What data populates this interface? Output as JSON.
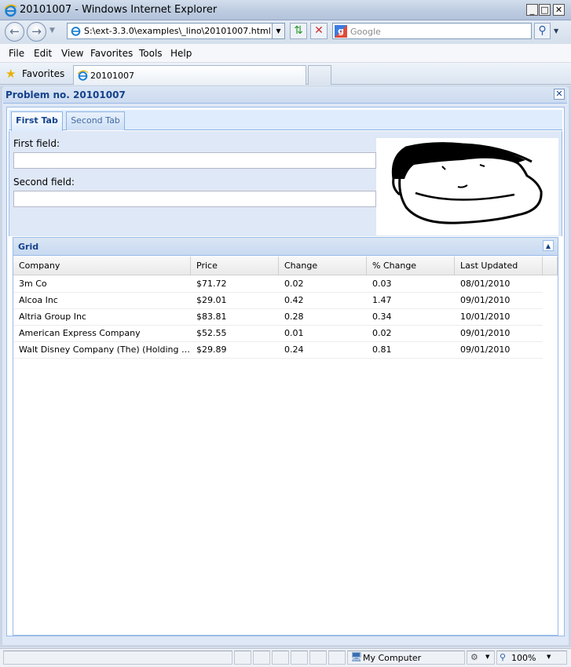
{
  "window": {
    "title": "20101007 - Windows Internet Explorer",
    "minimize": "_",
    "maximize": "□",
    "close": "✕"
  },
  "address_bar": {
    "url": "S:\\ext-3.3.0\\examples\\_lino\\20101007.html",
    "search_placeholder": "Google"
  },
  "menu": [
    "File",
    "Edit",
    "View",
    "Favorites",
    "Tools",
    "Help"
  ],
  "favorites": {
    "label": "Favorites",
    "tab_label": "20101007"
  },
  "panel": {
    "title": "Problem no. 20101007"
  },
  "tabs": [
    {
      "label": "First Tab",
      "active": true
    },
    {
      "label": "Second Tab",
      "active": false
    }
  ],
  "form": {
    "first_label": "First field:",
    "second_label": "Second field:",
    "first_value": "",
    "second_value": ""
  },
  "grid": {
    "title": "Grid",
    "columns": [
      "Company",
      "Price",
      "Change",
      "% Change",
      "Last Updated"
    ],
    "rows": [
      [
        "3m Co",
        "$71.72",
        "0.02",
        "0.03",
        "08/01/2010"
      ],
      [
        "Alcoa Inc",
        "$29.01",
        "0.42",
        "1.47",
        "09/01/2010"
      ],
      [
        "Altria Group Inc",
        "$83.81",
        "0.28",
        "0.34",
        "10/01/2010"
      ],
      [
        "American Express Company",
        "$52.55",
        "0.01",
        "0.02",
        "09/01/2010"
      ],
      [
        "Walt Disney Company (The) (Holding Company)",
        "$29.89",
        "0.24",
        "0.81",
        "09/01/2010"
      ]
    ]
  },
  "status_bar": {
    "zone": "My Computer",
    "zoom": "100%"
  },
  "colors": {
    "ext_title_blue": "#15428b",
    "ext_border": "#99bbe8",
    "ext_panel_bg": "#dfe8f6"
  }
}
